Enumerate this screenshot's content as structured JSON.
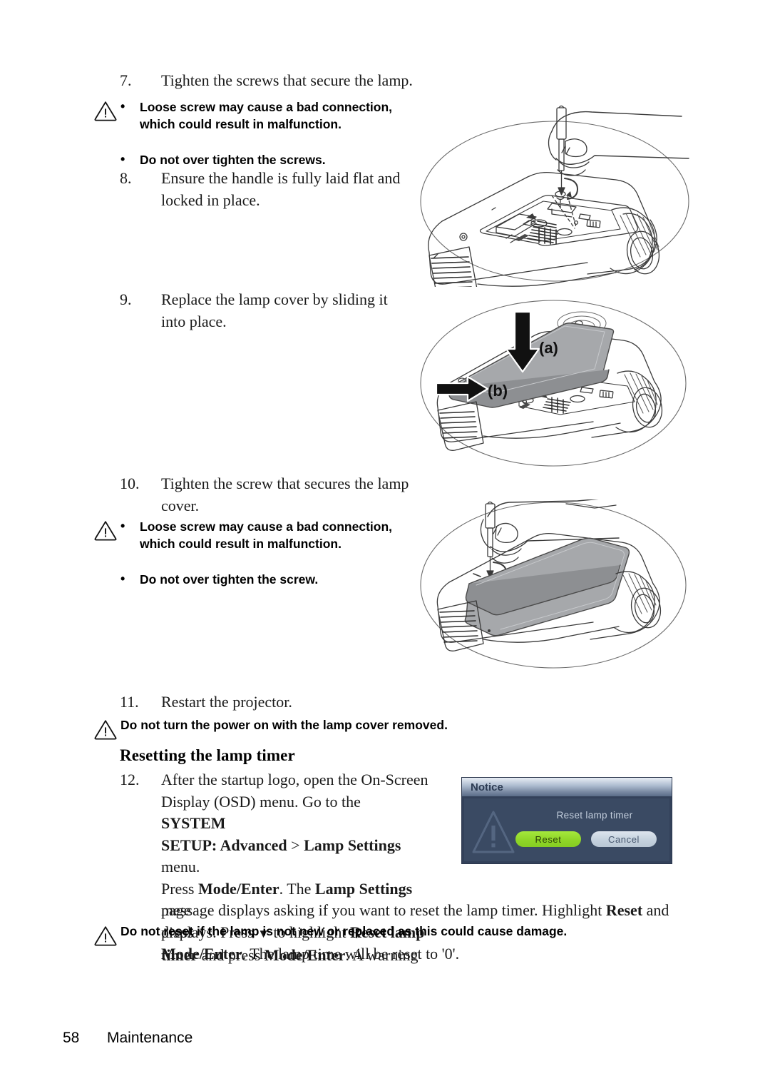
{
  "document": {
    "footer": {
      "page_number": "58",
      "section": "Maintenance"
    }
  },
  "steps": [
    {
      "number": "7.",
      "text": "Tighten the screws that secure the lamp."
    },
    {
      "number": "8.",
      "text": "Ensure the handle is fully laid flat and locked in place."
    },
    {
      "number": "9.",
      "text": "Replace the lamp cover by sliding it into place."
    },
    {
      "number": "10.",
      "text": "Tighten the screw that secures the lamp cover."
    },
    {
      "number": "11.",
      "text": "Restart the projector."
    },
    {
      "number": "12."
    }
  ],
  "warnings": {
    "after_step_7": {
      "icon": "warning-triangle-icon",
      "bullets": [
        "Loose screw may cause a bad connection, which could result in malfunction.",
        "Do not over tighten the screws."
      ]
    },
    "after_step_10": {
      "icon": "warning-triangle-icon",
      "bullets": [
        "Loose screw may cause a bad connection, which could result in malfunction.",
        "Do not over tighten the screw."
      ]
    },
    "after_step_11": {
      "icon": "warning-triangle-icon",
      "text": "Do not turn the power on with the lamp cover removed."
    },
    "after_step_12": {
      "icon": "warning-triangle-icon",
      "text": "Do not reset if the lamp is not new or replaced as this could cause damage."
    }
  },
  "section_heading": "Resetting the lamp timer",
  "step12_paragraph": {
    "parts": [
      {
        "text": "After the startup logo, open the On-Screen Display (OSD) menu. Go to the ",
        "bold": false
      },
      {
        "text": "SYSTEM SETUP: Advanced",
        "bold": true
      },
      {
        "text": " > ",
        "bold": false
      },
      {
        "text": "Lamp Settings",
        "bold": true
      },
      {
        "text": " menu. Press ",
        "bold": false
      },
      {
        "text": "Mode/Enter",
        "bold": true
      },
      {
        "text": ". The ",
        "bold": false
      },
      {
        "text": "Lamp Settings",
        "bold": true
      },
      {
        "text": " page displays. Press ",
        "bold": false
      },
      {
        "text": "▼",
        "bold": false
      },
      {
        "text": " to highlight ",
        "bold": false
      },
      {
        "text": "Reset lamp timer",
        "bold": true
      },
      {
        "text": " and press ",
        "bold": false
      },
      {
        "text": "Mode/Enter",
        "bold": true
      },
      {
        "text": ". A warning message displays asking if you want to reset the lamp timer. Highlight ",
        "bold": false
      },
      {
        "text": "Reset",
        "bold": true
      },
      {
        "text": " and press ",
        "bold": false
      },
      {
        "text": "Mode/Enter",
        "bold": true
      },
      {
        "text": ". The lamp time will be reset to '0'.",
        "bold": false
      }
    ],
    "line1": "After the startup logo, open the On-Screen",
    "line2_plain": "Display (OSD) menu. Go to the ",
    "line2_bold": "SYSTEM",
    "line3_bold1": "SETUP: Advanced",
    "line3_plain1": " > ",
    "line3_bold2": "Lamp Settings",
    "line3_plain2": " menu.",
    "line4_plain1": "Press ",
    "line4_bold1": "Mode/Enter",
    "line4_plain2": ". The ",
    "line4_bold2": "Lamp Settings",
    "line4_plain3": " page",
    "line5_plain1": "displays. Press ",
    "line5_arrow": "▼",
    "line5_plain2": " to highlight ",
    "line5_bold": "Reset lamp",
    "line6_bold1": "timer",
    "line6_plain1": " and press ",
    "line6_bold2": "Mode/Enter",
    "line6_plain2": ". A warning",
    "line7_plain1": "message displays asking if you want to reset the lamp timer. Highlight ",
    "line7_bold": "Reset",
    "line7_plain2": " and press",
    "line8_bold": "Mode/Enter",
    "line8_plain": ". The lamp time will be reset to '0'."
  },
  "osd_dialog": {
    "title": "Notice",
    "message": "Reset lamp timer",
    "icon": "warning-triangle-icon",
    "buttons": [
      {
        "label": "Reset",
        "state": "highlighted",
        "color": "#8fd628"
      },
      {
        "label": "Cancel",
        "state": "normal",
        "color": "#c5d2de"
      }
    ]
  },
  "illustrations": {
    "fig_step7": {
      "name": "projector-tighten-lamp-screws",
      "description": "Hand with screwdriver tightening lamp screws on open projector lamp compartment"
    },
    "fig_step9": {
      "name": "projector-replace-lamp-cover",
      "labels": [
        "(a)",
        "(b)"
      ],
      "description": "Lamp cover being slid into place with downward arrow (a) and sideways arrow (b)"
    },
    "fig_step10": {
      "name": "projector-tighten-cover-screw",
      "description": "Hand with screwdriver tightening the lamp cover screw"
    }
  }
}
